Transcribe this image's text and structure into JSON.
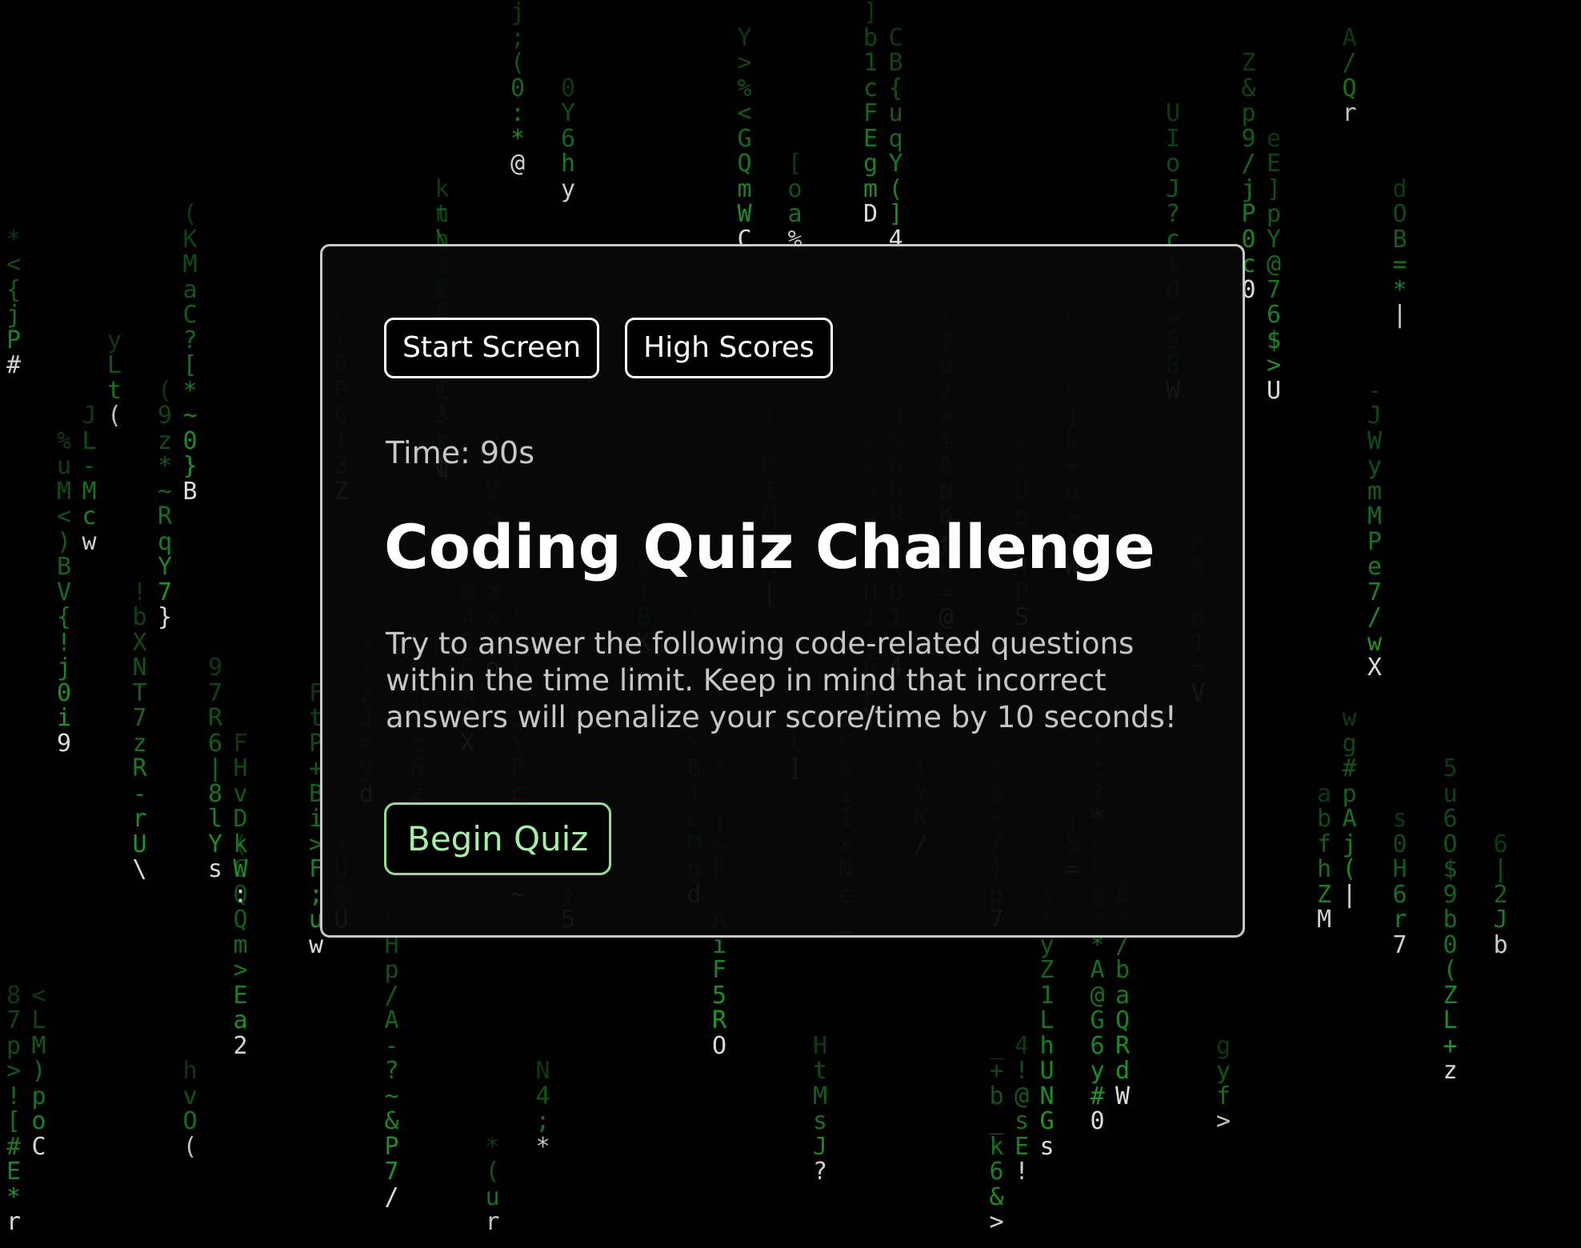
{
  "nav": {
    "start_label": "Start Screen",
    "highscores_label": "High Scores"
  },
  "quiz": {
    "timer_text": "Time: 90s",
    "title": "Coding Quiz Challenge",
    "instructions": "Try to answer the following code-related questions within the time limit. Keep in mind that incorrect answers will penalize your score/time by 10 seconds!",
    "begin_label": "Begin Quiz"
  },
  "theme": {
    "background": "#000000",
    "rain_green": "#1fa82a",
    "rain_head": "#e8e8e8",
    "card_border": "#c9c9c9",
    "begin_accent": "#8fe38f"
  }
}
